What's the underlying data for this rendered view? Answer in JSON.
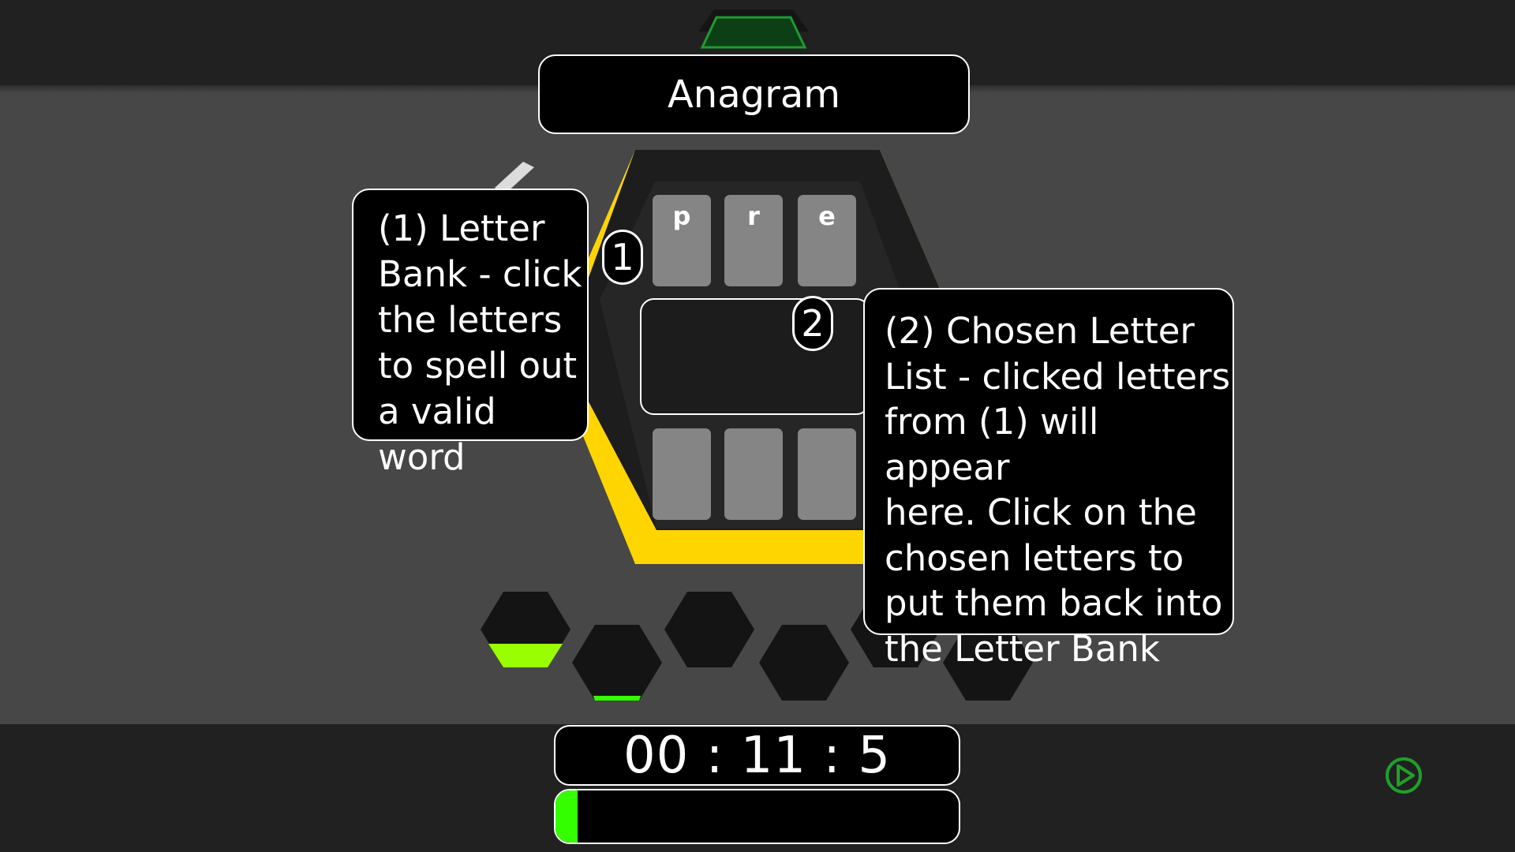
{
  "title": "Anagram",
  "letter_bank": [
    "p",
    "r",
    "e"
  ],
  "chosen_letters": [
    "",
    "",
    ""
  ],
  "markers": {
    "one": "1",
    "two": "2"
  },
  "tips": {
    "letter_bank": "(1) Letter Bank - click the letters to spell out a valid word",
    "chosen_list": "(2) Chosen Letter List - clicked letters from (1) will appear here. Click on the chosen letters to put them back into the Letter Bank"
  },
  "tip1_lines": [
    "(1) Letter",
    "Bank - click",
    "the letters",
    "to spell out",
    "a valid word"
  ],
  "tip2_lines": [
    "(2) Chosen Letter",
    "List - clicked letters",
    "from (1) will appear",
    "here. Click on the",
    "chosen letters to",
    "put them back into",
    "the Letter Bank"
  ],
  "timer": "00 : 11 : 5",
  "timer_progress": 0.055,
  "level_hexes": [
    {
      "state": "in-progress",
      "progress": 0.3
    },
    {
      "state": "in-progress",
      "progress": 0.06
    },
    {
      "state": "locked",
      "progress": 0
    },
    {
      "state": "locked",
      "progress": 0
    },
    {
      "state": "locked",
      "progress": 0
    },
    {
      "state": "locked",
      "progress": 0
    }
  ],
  "colors": {
    "accent_yellow": "#ffd500",
    "accent_green": "#33ff00",
    "progress_lime": "#99ff00",
    "button_green": "#1fa02a"
  },
  "icons": {
    "next": "play-icon"
  }
}
